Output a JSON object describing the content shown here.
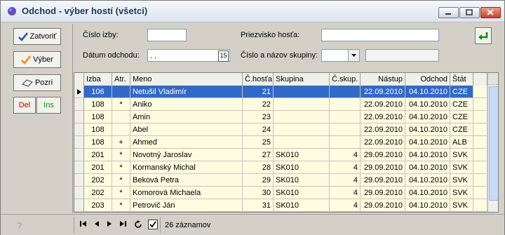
{
  "window": {
    "title": "Odchod - výber hostí (všetci)"
  },
  "buttons": {
    "close": "Zatvoriť",
    "select": "Výber",
    "view": "Pozri",
    "del": "Del",
    "ins": "Ins"
  },
  "filters": {
    "room_label": "Číslo izby:",
    "room_value": "",
    "surname_label": "Priezvisko hosťa:",
    "surname_value": "",
    "departure_label": "Dátum odchodu:",
    "departure_value": ". .",
    "calendar_icon_text": "15",
    "group_label": "Číslo a názov skupiny:",
    "group_value": "",
    "group_name_value": ""
  },
  "columns": [
    "Izba",
    "Atr.",
    "Meno",
    "Č.hosťa",
    "Skupina",
    "Č.skup.",
    "Nástup",
    "Odchod",
    "Štát"
  ],
  "rows": [
    {
      "izba": "106",
      "atr": "",
      "meno": "Netušil Vladimír",
      "cislo": "21",
      "skupina": "",
      "cskup": "",
      "nastup": "22.09.2010",
      "odchod": "04.10.2010",
      "stat": "CZE",
      "selected": true
    },
    {
      "izba": "108",
      "atr": "*",
      "meno": "Aniko",
      "cislo": "22",
      "skupina": "",
      "cskup": "",
      "nastup": "22.09.2010",
      "odchod": "04.10.2010",
      "stat": "CZE"
    },
    {
      "izba": "108",
      "atr": "",
      "meno": "Amin",
      "cislo": "23",
      "skupina": "",
      "cskup": "",
      "nastup": "22.09.2010",
      "odchod": "04.10.2010",
      "stat": "CZE"
    },
    {
      "izba": "108",
      "atr": "",
      "meno": "Abel",
      "cislo": "24",
      "skupina": "",
      "cskup": "",
      "nastup": "22.09.2010",
      "odchod": "04.10.2010",
      "stat": "CZE"
    },
    {
      "izba": "108",
      "atr": "+",
      "meno": "Ahmed",
      "cislo": "25",
      "skupina": "",
      "cskup": "",
      "nastup": "22.09.2010",
      "odchod": "04.10.2010",
      "stat": "ALB"
    },
    {
      "izba": "201",
      "atr": "*",
      "meno": "Novotný Jaroslav",
      "cislo": "27",
      "skupina": "SK010",
      "cskup": "4",
      "nastup": "29.09.2010",
      "odchod": "04.10.2010",
      "stat": "SVK"
    },
    {
      "izba": "201",
      "atr": "*",
      "meno": "Kormanský Michal",
      "cislo": "28",
      "skupina": "SK010",
      "cskup": "4",
      "nastup": "29.09.2010",
      "odchod": "04.10.2010",
      "stat": "SVK"
    },
    {
      "izba": "202",
      "atr": "*",
      "meno": "Beková Petra",
      "cislo": "29",
      "skupina": "SK010",
      "cskup": "4",
      "nastup": "29.09.2010",
      "odchod": "04.10.2010",
      "stat": "SVK"
    },
    {
      "izba": "202",
      "atr": "*",
      "meno": "Komorová Michaela",
      "cislo": "30",
      "skupina": "SK010",
      "cskup": "4",
      "nastup": "29.09.2010",
      "odchod": "04.10.2010",
      "stat": "SVK"
    },
    {
      "izba": "203",
      "atr": "*",
      "meno": "Petrovič Ján",
      "cislo": "31",
      "skupina": "SK010",
      "cskup": "4",
      "nastup": "29.09.2010",
      "odchod": "04.10.2010",
      "stat": "SVK"
    }
  ],
  "status": {
    "count_text": "26 záznamov"
  },
  "colors": {
    "selected": "#3169c6",
    "row_bg": "#fdfbe0"
  }
}
